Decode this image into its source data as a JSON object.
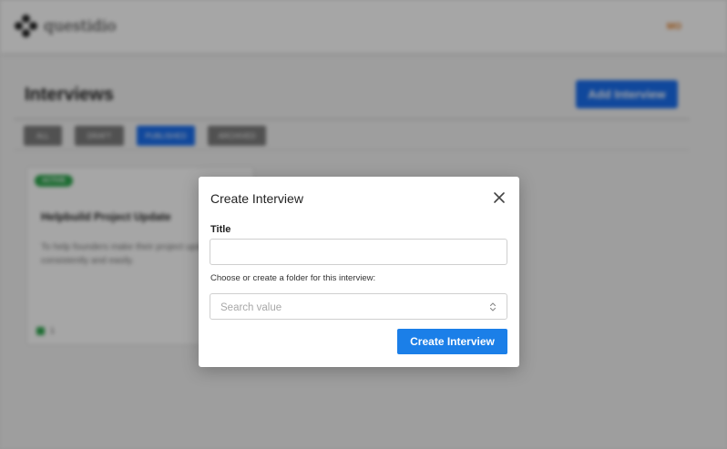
{
  "app": {
    "logo_text": "questidio",
    "user_badge": "MO",
    "page_title": "Interviews",
    "add_button_label": "Add Interview",
    "filters": [
      {
        "label": "ALL",
        "active": false
      },
      {
        "label": "DRAFT",
        "active": false
      },
      {
        "label": "PUBLISHED",
        "active": true
      },
      {
        "label": "ARCHIVED",
        "active": false
      }
    ],
    "card": {
      "status": "ACTIVE",
      "title": "Helpbuild Project Update",
      "description": "To help founders make their project updates consistently and easily.",
      "response_count": "1"
    }
  },
  "modal": {
    "title": "Create Interview",
    "title_label": "Title",
    "title_value": "",
    "folder_label": "Choose or create a folder for this interview:",
    "folder_placeholder": "Search value",
    "submit_label": "Create Interview"
  },
  "colors": {
    "accent": "#1b7fe8",
    "active_badge": "#2fa84f",
    "overlay": "rgba(0,0,0,0.35)"
  },
  "icons": {
    "close": "close-icon",
    "select_caret": "chevron-up-down-icon",
    "logo": "logo-icon"
  }
}
